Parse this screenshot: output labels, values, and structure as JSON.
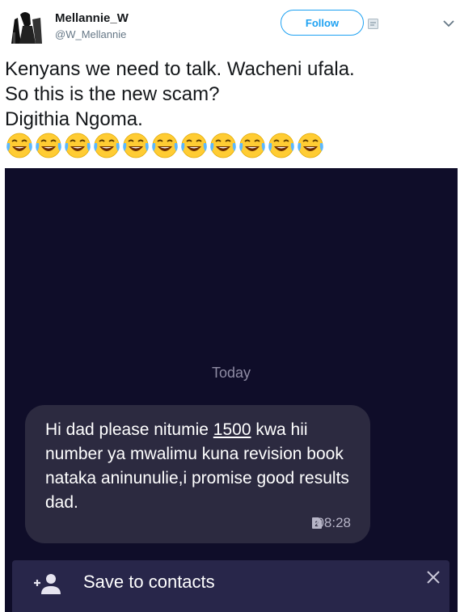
{
  "tweet": {
    "author_name": "Mellannie_W",
    "author_handle": "@W_Mellannie",
    "follow_label": "Follow",
    "lines": [
      "Kenyans we need to talk. Wacheni ufala.",
      "So this is the new scam?",
      "Digithia Ngoma."
    ],
    "emoji_count": 11,
    "emoji_name": "face-with-tears-of-joy"
  },
  "screenshot": {
    "date_divider": "Today",
    "message_parts": {
      "before": "Hi dad please nitumie ",
      "amount": "1500",
      "after": " kwa hii number ya mwalimu kuna revision book nataka aninunulie,i promise good results dad."
    },
    "sim_slot": "2",
    "time": "08:28",
    "save_label": "Save to contacts"
  },
  "colors": {
    "accent": "#1da1f2",
    "media_bg": "#0f0d29",
    "bubble_bg": "#2c2a40",
    "save_bar_bg": "#28264a"
  }
}
